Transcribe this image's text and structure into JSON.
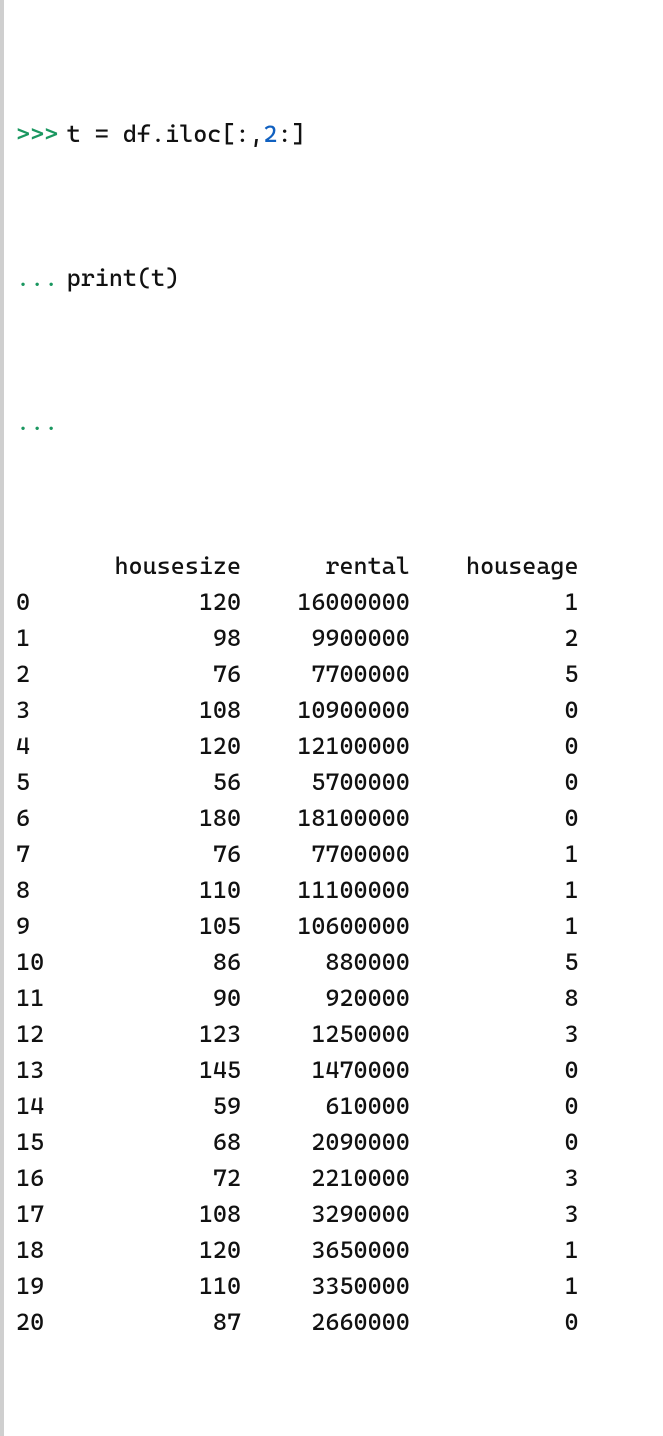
{
  "prompts": {
    "primary": ">>>",
    "continuation": "..."
  },
  "code": {
    "line1_pre": "t = df.iloc[:,",
    "line1_num": "2",
    "line1_post": ":]",
    "line2": "print(t)"
  },
  "columns": [
    "housesize",
    "rental",
    "houseage"
  ],
  "index_col_width": 3,
  "col_widths": {
    "housesize": 11,
    "rental": 10,
    "houseage": 10
  },
  "rows": [
    {
      "idx": "0",
      "housesize": 120,
      "rental": 16000000,
      "houseage": 1
    },
    {
      "idx": "1",
      "housesize": 98,
      "rental": 9900000,
      "houseage": 2
    },
    {
      "idx": "2",
      "housesize": 76,
      "rental": 7700000,
      "houseage": 5
    },
    {
      "idx": "3",
      "housesize": 108,
      "rental": 10900000,
      "houseage": 0
    },
    {
      "idx": "4",
      "housesize": 120,
      "rental": 12100000,
      "houseage": 0
    },
    {
      "idx": "5",
      "housesize": 56,
      "rental": 5700000,
      "houseage": 0
    },
    {
      "idx": "6",
      "housesize": 180,
      "rental": 18100000,
      "houseage": 0
    },
    {
      "idx": "7",
      "housesize": 76,
      "rental": 7700000,
      "houseage": 1
    },
    {
      "idx": "8",
      "housesize": 110,
      "rental": 11100000,
      "houseage": 1
    },
    {
      "idx": "9",
      "housesize": 105,
      "rental": 10600000,
      "houseage": 1
    },
    {
      "idx": "10",
      "housesize": 86,
      "rental": 880000,
      "houseage": 5
    },
    {
      "idx": "11",
      "housesize": 90,
      "rental": 920000,
      "houseage": 8
    },
    {
      "idx": "12",
      "housesize": 123,
      "rental": 1250000,
      "houseage": 3
    },
    {
      "idx": "13",
      "housesize": 145,
      "rental": 1470000,
      "houseage": 0
    },
    {
      "idx": "14",
      "housesize": 59,
      "rental": 610000,
      "houseage": 0
    },
    {
      "idx": "15",
      "housesize": 68,
      "rental": 2090000,
      "houseage": 0
    },
    {
      "idx": "16",
      "housesize": 72,
      "rental": 2210000,
      "houseage": 3
    },
    {
      "idx": "17",
      "housesize": 108,
      "rental": 3290000,
      "houseage": 3
    },
    {
      "idx": "18",
      "housesize": 120,
      "rental": 3650000,
      "houseage": 1
    },
    {
      "idx": "19",
      "housesize": 110,
      "rental": 3350000,
      "houseage": 1
    },
    {
      "idx": "20",
      "housesize": 87,
      "rental": 2660000,
      "houseage": 0
    }
  ]
}
